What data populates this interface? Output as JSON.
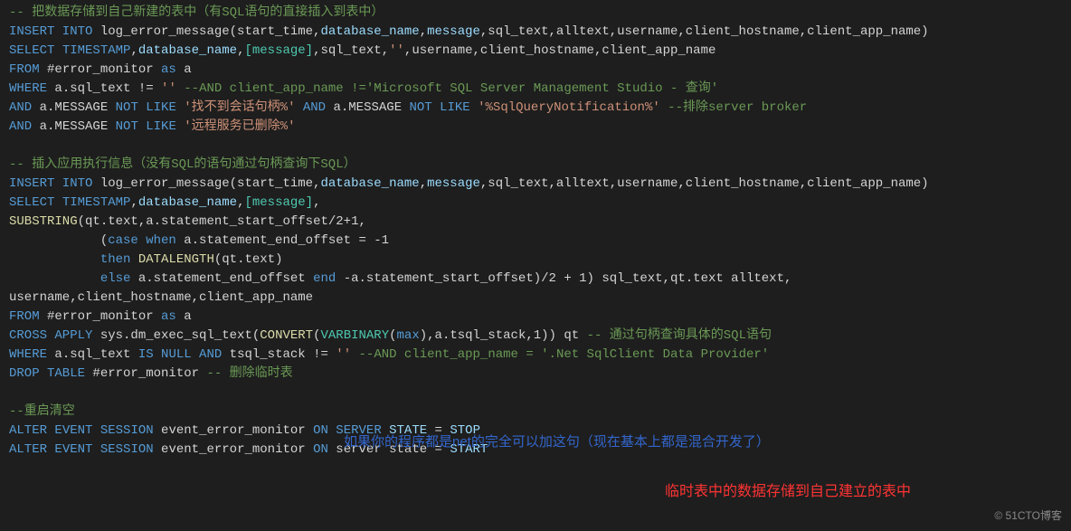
{
  "c1": "-- 把数据存储到自己新建的表中（有SQL语句的直接插入到表中）",
  "l2": {
    "k1": "INSERT INTO",
    "t1": " log_error_message(start_time,",
    "i1": "database_name",
    "t2": ",",
    "i2": "message",
    "t3": ",sql_text,alltext,username,client_hostname,client_app_name)"
  },
  "l3": {
    "k1": "SELECT",
    "k2": " TIMESTAMP",
    "t1": ",",
    "i1": "database_name",
    "t2": ",",
    "b1": "[message]",
    "t3": ",sql_text,",
    "s1": "''",
    "t4": ",username,client_hostname,client_app_name"
  },
  "l4": {
    "k1": "FROM",
    "t1": " #error_monitor ",
    "k2": "as",
    "t2": " a"
  },
  "l5": {
    "k1": "WHERE",
    "t1": " a.sql_text != ",
    "s1": "''",
    "c1": " --AND client_app_name !='Microsoft SQL Server Management Studio - 查询'"
  },
  "l6": {
    "k1": "AND",
    "t1": " a.MESSAGE ",
    "k2": "NOT LIKE",
    "s1": " '找不到会话句柄%'",
    "k3": " AND",
    "t2": " a.MESSAGE ",
    "k4": "NOT LIKE",
    "s2": " '%SqlQueryNotification%'",
    "c1": " --排除server broker"
  },
  "l7": {
    "k1": "AND",
    "t1": " a.MESSAGE ",
    "k2": "NOT LIKE",
    "s1": " '远程服务已删除%'"
  },
  "c2": "-- 插入应用执行信息（没有SQL的语句通过句柄查询下SQL）",
  "l10": {
    "k1": "INSERT INTO",
    "t1": " log_error_message(start_time,",
    "i1": "database_name",
    "t2": ",",
    "i2": "message",
    "t3": ",sql_text,alltext,username,client_hostname,client_app_name)"
  },
  "l11": {
    "k1": "SELECT",
    "k2": " TIMESTAMP",
    "t1": ",",
    "i1": "database_name",
    "t2": ",",
    "b1": "[message]",
    "t3": ","
  },
  "l12": {
    "f1": "SUBSTRING",
    "t1": "(qt.text,a.statement_start_offset/2+1,"
  },
  "l13": {
    "t1": "            (",
    "k1": "case when",
    "t2": " a.statement_end_offset = -1"
  },
  "l14": {
    "t1": "            ",
    "k1": "then",
    "f1": " DATALENGTH",
    "t2": "(qt.text)"
  },
  "l15": {
    "t1": "            ",
    "k1": "else",
    "t2": " a.statement_end_offset ",
    "k2": "end",
    "t3": " -a.statement_start_offset)/2 + 1) sql_text,qt.text alltext,"
  },
  "l16": {
    "t1": "username,client_hostname,client_app_name"
  },
  "l17": {
    "k1": "FROM",
    "t1": " #error_monitor ",
    "k2": "as",
    "t2": " a"
  },
  "l18": {
    "k1": "CROSS APPLY",
    "t1": " sys.dm_exec_sql_text(",
    "f1": "CONVERT",
    "t2": "(",
    "b1": "VARBINARY",
    "t3": "(",
    "k2": "max",
    "t4": "),a.tsql_stack,1)) qt ",
    "c1": "-- 通过句柄查询具体的SQL语句"
  },
  "l19": {
    "k1": "WHERE",
    "t1": " a.sql_text ",
    "k2": "IS NULL AND",
    "t2": " tsql_stack != ",
    "s1": "''",
    "c1": " --AND client_app_name = '.Net SqlClient Data Provider'"
  },
  "l20": {
    "k1": "DROP TABLE",
    "t1": " #error_monitor ",
    "c1": "-- 删除临时表"
  },
  "c3": "--重启清空",
  "l22": {
    "k1": "ALTER",
    "k2": " EVENT",
    "k3": " SESSION",
    "t1": " event_error_monitor ",
    "k4": "ON",
    "k5": " SERVER ",
    "i1": "STATE",
    "t2": " = ",
    "i2": "STOP"
  },
  "l23": {
    "k1": "ALTER",
    "k2": " EVENT",
    "k3": " SESSION",
    "t1": " event_error_monitor ",
    "k4": "ON",
    "t2": " server state = ",
    "i1": "START"
  },
  "ann1": "如果你的程序都是net的完全可以加这句（现在基本上都是混合开发了）",
  "ann2": "临时表中的数据存储到自己建立的表中",
  "watermark": "© 51CTO博客"
}
